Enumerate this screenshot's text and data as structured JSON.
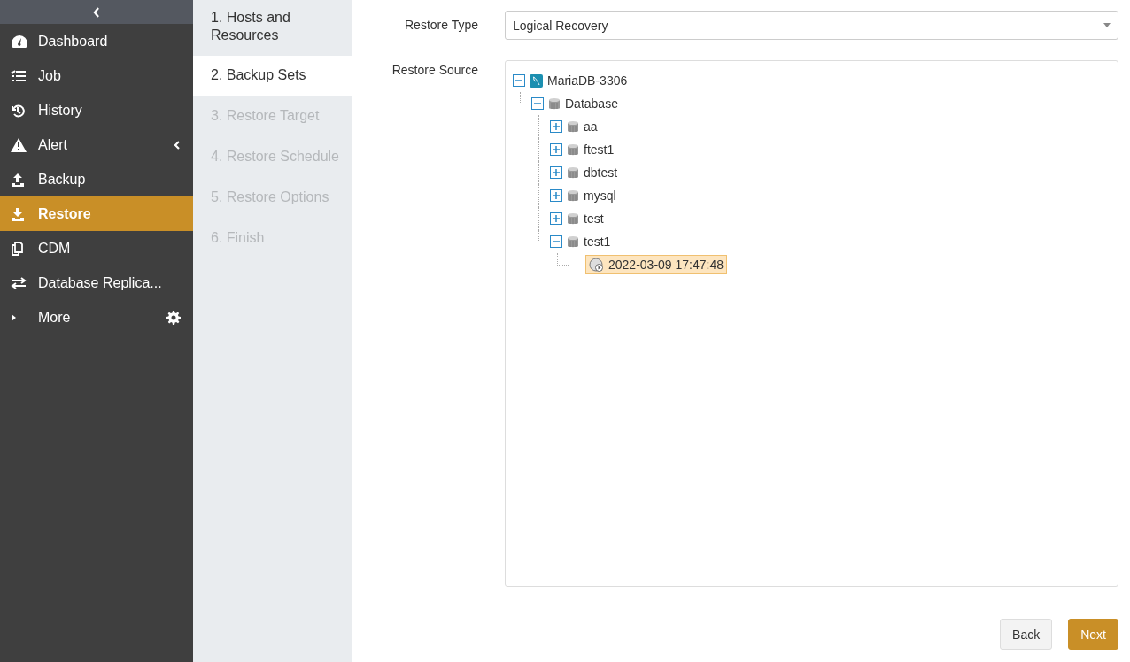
{
  "sidebar": {
    "items": [
      {
        "label": "Dashboard",
        "selected": false
      },
      {
        "label": "Job",
        "selected": false
      },
      {
        "label": "History",
        "selected": false
      },
      {
        "label": "Alert",
        "selected": false,
        "expanded": false
      },
      {
        "label": "Backup",
        "selected": false
      },
      {
        "label": "Restore",
        "selected": true
      },
      {
        "label": "CDM",
        "selected": false
      },
      {
        "label": "Database Replica...",
        "selected": false
      },
      {
        "label": "More",
        "selected": false
      }
    ]
  },
  "steps": [
    {
      "label": "1. Hosts and Resources",
      "selected": false,
      "disabled": false
    },
    {
      "label": "2. Backup Sets",
      "selected": true,
      "disabled": false
    },
    {
      "label": "3. Restore Target",
      "selected": false,
      "disabled": true
    },
    {
      "label": "4. Restore Schedule",
      "selected": false,
      "disabled": true
    },
    {
      "label": "5. Restore Options",
      "selected": false,
      "disabled": true
    },
    {
      "label": "6. Finish",
      "selected": false,
      "disabled": true
    }
  ],
  "restore_type": {
    "label": "Restore Type",
    "value": "Logical Recovery"
  },
  "restore_source": {
    "label": "Restore Source",
    "tree": [
      {
        "kind": "server",
        "label": "MariaDB-3306",
        "expanded": true,
        "selected": false,
        "children": [
          {
            "kind": "group",
            "label": "Database",
            "expanded": true,
            "selected": false,
            "children": [
              {
                "kind": "database",
                "label": "aa",
                "expanded": false,
                "selected": false
              },
              {
                "kind": "database",
                "label": "ftest1",
                "expanded": false,
                "selected": false
              },
              {
                "kind": "database",
                "label": "dbtest",
                "expanded": false,
                "selected": false
              },
              {
                "kind": "database",
                "label": "mysql",
                "expanded": false,
                "selected": false
              },
              {
                "kind": "database",
                "label": "test",
                "expanded": false,
                "selected": false
              },
              {
                "kind": "database",
                "label": "test1",
                "expanded": true,
                "selected": false,
                "children": [
                  {
                    "kind": "backup",
                    "label": "2022-03-09 17:47:48",
                    "selected": true
                  }
                ]
              }
            ]
          }
        ]
      }
    ]
  },
  "buttons": [
    {
      "label": "Back",
      "kind": "secondary"
    },
    {
      "label": "Next",
      "kind": "primary"
    }
  ]
}
